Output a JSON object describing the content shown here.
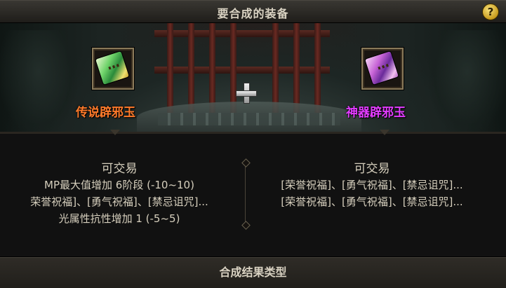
{
  "header": {
    "title": "要合成的装备",
    "help_icon": "question-icon"
  },
  "colors": {
    "legendary": "#ff7a2a",
    "epic": "#e23cff",
    "text": "#d6cfbd"
  },
  "left_item": {
    "name": "传说辟邪玉",
    "icon": "legendary-jade-icon",
    "trade_status": "可交易",
    "stats": [
      "MP最大值增加 6阶段 (-10~10)",
      "荣誉祝福]、[勇气祝福]、[禁忌诅咒]...",
      "光属性抗性增加 1 (-5~5)"
    ]
  },
  "right_item": {
    "name": "神器辟邪玉",
    "icon": "epic-jade-icon",
    "trade_status": "可交易",
    "stats": [
      "[荣誉祝福]、[勇气祝福]、[禁忌诅咒]...",
      "[荣誉祝福]、[勇气祝福]、[禁忌诅咒]..."
    ]
  },
  "combine_icon": "plus-icon",
  "footer": {
    "title": "合成结果类型"
  }
}
